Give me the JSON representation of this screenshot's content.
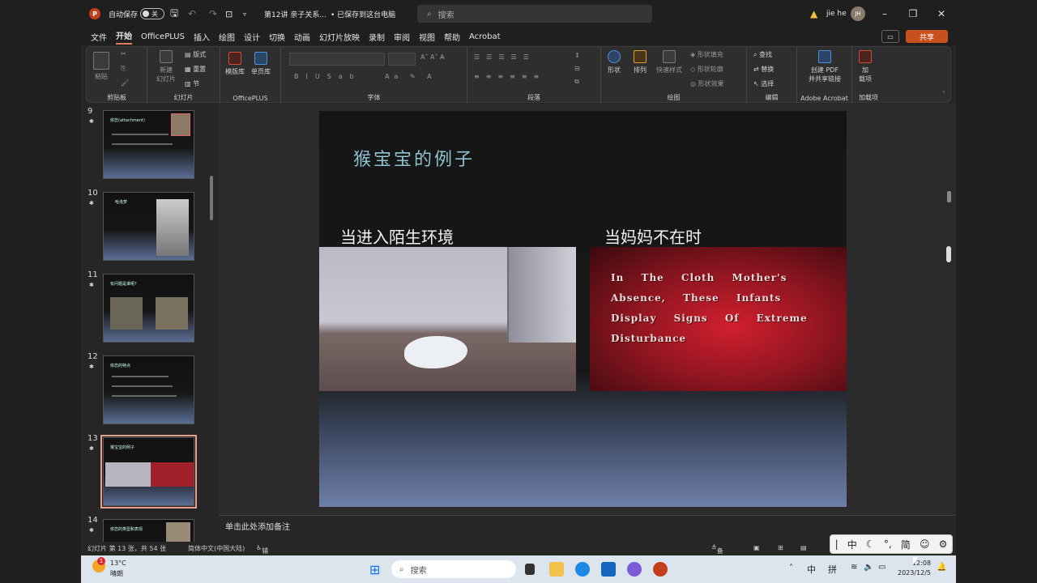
{
  "titlebar": {
    "autosave_label": "自动保存",
    "autosave_state": "关",
    "doc_title": "第12讲 亲子关系...",
    "save_status": "• 已保存到这台电脑",
    "search_placeholder": "搜索",
    "user_name": "jie he",
    "user_initials": "JH"
  },
  "menu": {
    "items": [
      "文件",
      "开始",
      "OfficePLUS",
      "插入",
      "绘图",
      "设计",
      "切换",
      "动画",
      "幻灯片放映",
      "录制",
      "审阅",
      "视图",
      "帮助",
      "Acrobat"
    ],
    "share_label": "共享"
  },
  "ribbon": {
    "clipboard": {
      "paste": "粘贴",
      "label": "剪贴板"
    },
    "slides": {
      "new_slide": "新建\n幻灯片",
      "layout": "版式",
      "reset": "重置",
      "section": "节",
      "label": "幻灯片"
    },
    "officeplus": {
      "template": "模版库",
      "single": "单页库",
      "label": "OfficePLUS"
    },
    "font": {
      "label": "字体"
    },
    "paragraph": {
      "label": "段落"
    },
    "drawing": {
      "shape": "形状",
      "arrange": "排列",
      "quick_style": "快速样式",
      "fill": "形状填充",
      "outline": "形状轮廓",
      "effect": "形状效果",
      "label": "绘图"
    },
    "editing": {
      "find": "查找",
      "replace": "替换",
      "select": "选择",
      "label": "编辑"
    },
    "acrobat": {
      "create": "创建 PDF\n并共享链接",
      "label": "Adobe Acrobat"
    },
    "addins": {
      "add": "加\n载项",
      "label": "加载项"
    }
  },
  "thumbnails": [
    {
      "num": "9",
      "title": "依恋(attachment)"
    },
    {
      "num": "10",
      "title": "哈洛梦"
    },
    {
      "num": "11",
      "title": "有问题是谁呢?"
    },
    {
      "num": "12",
      "title": "依恋的特点"
    },
    {
      "num": "13",
      "title": "猴宝宝的例子",
      "selected": true
    },
    {
      "num": "14",
      "title": "依恋的类型和表现"
    }
  ],
  "slide": {
    "title": "猴宝宝的例子",
    "caption_left": "当进入陌生环境",
    "caption_right": "当妈妈不在时",
    "video_text": "In The Cloth Mother's Absence, These Infants Display Signs Of Extreme Disturbance"
  },
  "notes": {
    "placeholder": "单击此处添加备注"
  },
  "status": {
    "slide_info": "幻灯片 第 13 张，共 54 张",
    "language": "简体中文(中国大陆)",
    "accessibility": "辅助功能: 调查",
    "notes_btn": "备注"
  },
  "ime": {
    "items": [
      "中",
      "简"
    ]
  },
  "taskbar": {
    "weather_temp": "13°C",
    "weather_desc": "晴朗",
    "badge": "1",
    "search": "搜索",
    "ime_lang": "中",
    "ime_mode": "拼",
    "time": "12:08",
    "date": "2023/12/5"
  }
}
